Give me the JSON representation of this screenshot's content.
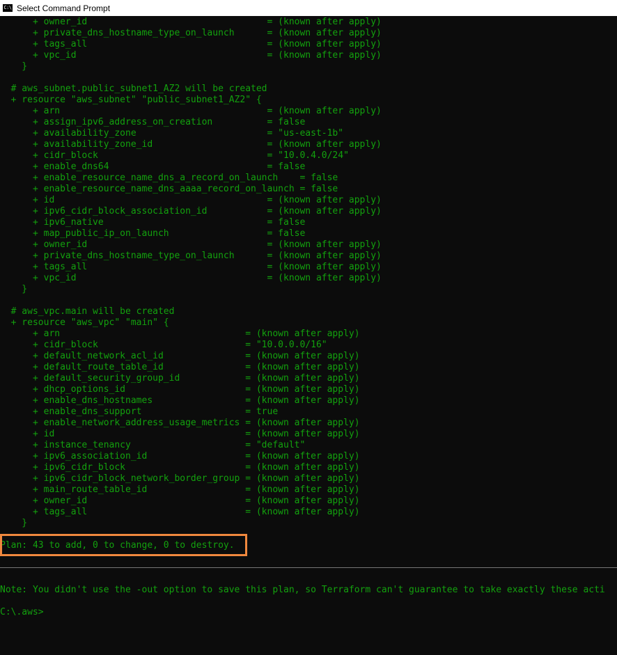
{
  "window": {
    "title": "Select Command Prompt",
    "icon_label": "C:\\"
  },
  "colors": {
    "text": "#13a10e",
    "background": "#0c0c0c",
    "highlight": "#f0883e"
  },
  "lines": [
    "      + owner_id                                 = (known after apply)",
    "      + private_dns_hostname_type_on_launch      = (known after apply)",
    "      + tags_all                                 = (known after apply)",
    "      + vpc_id                                   = (known after apply)",
    "    }",
    "",
    "  # aws_subnet.public_subnet1_AZ2 will be created",
    "  + resource \"aws_subnet\" \"public_subnet1_AZ2\" {",
    "      + arn                                      = (known after apply)",
    "      + assign_ipv6_address_on_creation          = false",
    "      + availability_zone                        = \"us-east-1b\"",
    "      + availability_zone_id                     = (known after apply)",
    "      + cidr_block                               = \"10.0.4.0/24\"",
    "      + enable_dns64                             = false",
    "      + enable_resource_name_dns_a_record_on_launch    = false",
    "      + enable_resource_name_dns_aaaa_record_on_launch = false",
    "      + id                                       = (known after apply)",
    "      + ipv6_cidr_block_association_id           = (known after apply)",
    "      + ipv6_native                              = false",
    "      + map_public_ip_on_launch                  = false",
    "      + owner_id                                 = (known after apply)",
    "      + private_dns_hostname_type_on_launch      = (known after apply)",
    "      + tags_all                                 = (known after apply)",
    "      + vpc_id                                   = (known after apply)",
    "    }",
    "",
    "  # aws_vpc.main will be created",
    "  + resource \"aws_vpc\" \"main\" {",
    "      + arn                                  = (known after apply)",
    "      + cidr_block                           = \"10.0.0.0/16\"",
    "      + default_network_acl_id               = (known after apply)",
    "      + default_route_table_id               = (known after apply)",
    "      + default_security_group_id            = (known after apply)",
    "      + dhcp_options_id                      = (known after apply)",
    "      + enable_dns_hostnames                 = (known after apply)",
    "      + enable_dns_support                   = true",
    "      + enable_network_address_usage_metrics = (known after apply)",
    "      + id                                   = (known after apply)",
    "      + instance_tenancy                     = \"default\"",
    "      + ipv6_association_id                  = (known after apply)",
    "      + ipv6_cidr_block                      = (known after apply)",
    "      + ipv6_cidr_block_network_border_group = (known after apply)",
    "      + main_route_table_id                  = (known after apply)",
    "      + owner_id                             = (known after apply)",
    "      + tags_all                             = (known after apply)",
    "    }",
    "",
    "Plan: 43 to add, 0 to change, 0 to destroy.",
    "",
    "",
    "",
    "Note: You didn't use the -out option to save this plan, so Terraform can't guarantee to take exactly these acti",
    "",
    "C:\\.aws>"
  ]
}
